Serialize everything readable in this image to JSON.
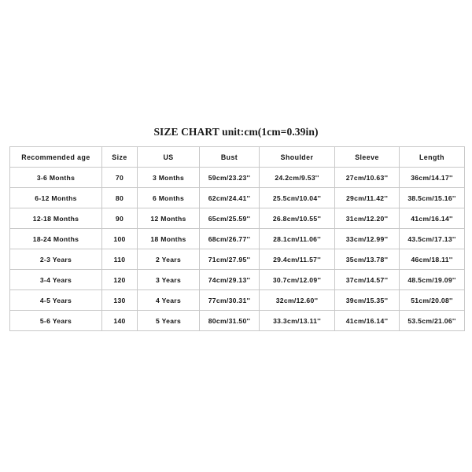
{
  "document": {
    "title": "SIZE CHART unit:cm(1cm=0.39in)"
  },
  "chart_data": {
    "type": "table",
    "title": "SIZE CHART unit:cm(1cm=0.39in)",
    "columns": [
      "Recommended age",
      "Size",
      "US",
      "Bust",
      "Shoulder",
      "Sleeve",
      "Length"
    ],
    "rows": [
      [
        "3-6 Months",
        "70",
        "3 Months",
        "59cm/23.23''",
        "24.2cm/9.53''",
        "27cm/10.63''",
        "36cm/14.17''"
      ],
      [
        "6-12 Months",
        "80",
        "6 Months",
        "62cm/24.41''",
        "25.5cm/10.04''",
        "29cm/11.42''",
        "38.5cm/15.16''"
      ],
      [
        "12-18 Months",
        "90",
        "12 Months",
        "65cm/25.59''",
        "26.8cm/10.55''",
        "31cm/12.20''",
        "41cm/16.14''"
      ],
      [
        "18-24 Months",
        "100",
        "18 Months",
        "68cm/26.77''",
        "28.1cm/11.06''",
        "33cm/12.99''",
        "43.5cm/17.13''"
      ],
      [
        "2-3 Years",
        "110",
        "2 Years",
        "71cm/27.95''",
        "29.4cm/11.57''",
        "35cm/13.78''",
        "46cm/18.11''"
      ],
      [
        "3-4 Years",
        "120",
        "3 Years",
        "74cm/29.13''",
        "30.7cm/12.09''",
        "37cm/14.57''",
        "48.5cm/19.09''"
      ],
      [
        "4-5 Years",
        "130",
        "4 Years",
        "77cm/30.31''",
        "32cm/12.60''",
        "39cm/15.35''",
        "51cm/20.08''"
      ],
      [
        "5-6 Years",
        "140",
        "5 Years",
        "80cm/31.50''",
        "33.3cm/13.11''",
        "41cm/16.14''",
        "53.5cm/21.06''"
      ]
    ]
  },
  "colors": {
    "page_background": "#ffffff",
    "cell_background": "#ffffff",
    "border": "#c8c8c8",
    "text": "#141414"
  }
}
